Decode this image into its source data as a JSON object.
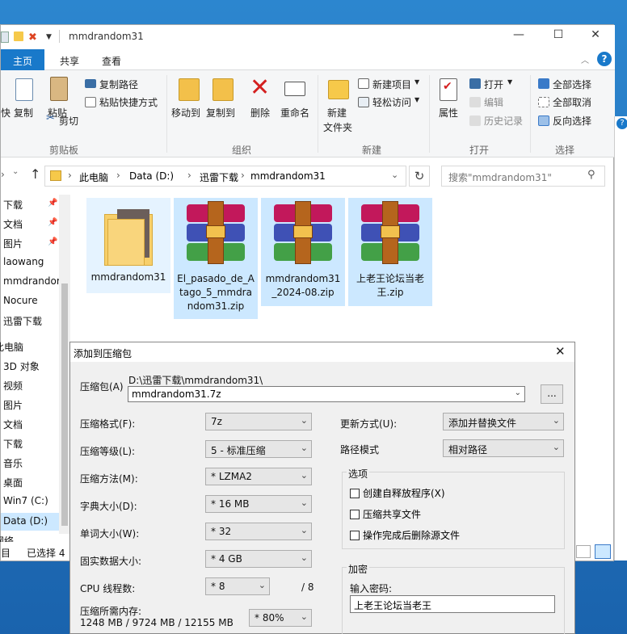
{
  "window": {
    "title": "mmdrandom31"
  },
  "controls": {
    "minimize": "—",
    "maximize": "☐",
    "close": "✕"
  },
  "tabs": {
    "file": "主页",
    "share": "共享",
    "view": "查看"
  },
  "ribbon": {
    "clipboard": {
      "group": "剪贴板",
      "copy": "复制",
      "paste": "粘贴",
      "copy_path": "复制路径",
      "paste_shortcut": "粘贴快捷方式",
      "cut": "剪切",
      "partial_left": "快"
    },
    "organize": {
      "group": "组织",
      "move_to": "移动到",
      "copy_to": "复制到",
      "delete": "删除",
      "rename": "重命名"
    },
    "new": {
      "group": "新建",
      "new_folder": "新建\n文件夹",
      "new_item": "新建项目",
      "easy_access": "轻松访问"
    },
    "open": {
      "group": "打开",
      "properties": "属性",
      "open": "打开",
      "edit": "编辑",
      "history": "历史记录"
    },
    "select": {
      "group": "选择",
      "select_all": "全部选择",
      "select_none": "全部取消",
      "invert": "反向选择"
    }
  },
  "address": {
    "crumbs": [
      "此电脑",
      "Data (D:)",
      "迅雷下载",
      "mmdrandom31"
    ],
    "search_placeholder": "搜索\"mmdrandom31\""
  },
  "nav": {
    "items": [
      "下载",
      "文档",
      "图片",
      "laowang",
      "mmdrandom",
      "Nocure",
      "迅雷下载",
      "此电脑",
      "3D 对象",
      "视频",
      "图片",
      "文档",
      "下载",
      "音乐",
      "桌面",
      "Win7 (C:)",
      "Data (D:)",
      "网络"
    ]
  },
  "files": [
    {
      "name": "mmdrandom31",
      "type": "folder"
    },
    {
      "name": "El_pasado_de_Atago_5_mmdrandom31.zip",
      "type": "zip"
    },
    {
      "name": "mmdrandom31_2024-08.zip",
      "type": "zip"
    },
    {
      "name": "上老王论坛当老王.zip",
      "type": "zip"
    }
  ],
  "status": {
    "count": "目",
    "selected": "已选择 4"
  },
  "dialog": {
    "title": "添加到压缩包",
    "archive_label": "压缩包(A)",
    "archive_path": "D:\\迅雷下载\\mmdrandom31\\",
    "archive_name": "mmdrandom31.7z",
    "browse": "...",
    "format_label": "压缩格式(F):",
    "format": "7z",
    "level_label": "压缩等级(L):",
    "level": "5 - 标准压缩",
    "method_label": "压缩方法(M):",
    "method": "* LZMA2",
    "dict_label": "字典大小(D):",
    "dict": "* 16 MB",
    "word_label": "单词大小(W):",
    "word": "* 32",
    "solid_label": "固实数据大小:",
    "solid": "* 4 GB",
    "cpu_label": "CPU 线程数:",
    "cpu": "* 8",
    "cpu_max": "/ 8",
    "mem_label": "压缩所需内存:",
    "mem_values": "1248 MB / 9724 MB / 12155 MB",
    "mem_pct": "* 80%",
    "update_label": "更新方式(U):",
    "update": "添加并替换文件",
    "path_label": "路径模式",
    "path": "相对路径",
    "options_title": "选项",
    "opt_sfx": "创建自释放程序(X)",
    "opt_shared": "压缩共享文件",
    "opt_delete": "操作完成后删除源文件",
    "encrypt_title": "加密",
    "pwd_label": "输入密码:",
    "pwd_value": "上老王论坛当老王"
  }
}
